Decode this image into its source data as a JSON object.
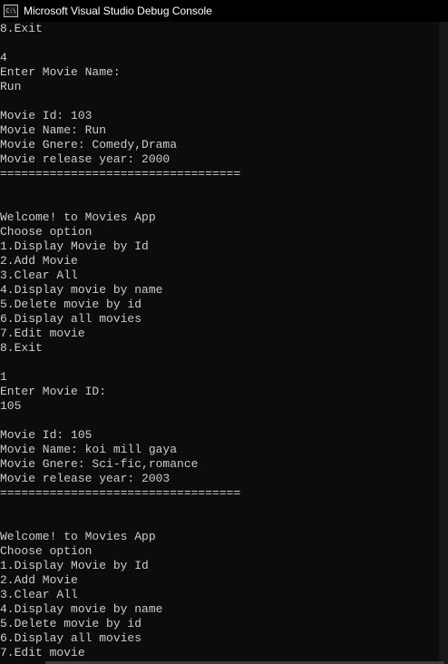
{
  "window": {
    "title": "Microsoft Visual Studio Debug Console",
    "icon": "console-app-icon",
    "icon_glyph": "C:\\"
  },
  "console": {
    "lines": [
      "8.Exit",
      "",
      "4",
      "Enter Movie Name:",
      "Run",
      "",
      "Movie Id: 103",
      "Movie Name: Run",
      "Movie Gnere: Comedy,Drama",
      "Movie release year: 2000",
      "==================================",
      "",
      "",
      "Welcome! to Movies App",
      "Choose option",
      "1.Display Movie by Id",
      "2.Add Movie",
      "3.Clear All",
      "4.Display movie by name",
      "5.Delete movie by id",
      "6.Display all movies",
      "7.Edit movie",
      "8.Exit",
      "",
      "1",
      "Enter Movie ID:",
      "105",
      "",
      "Movie Id: 105",
      "Movie Name: koi mill gaya",
      "Movie Gnere: Sci-fic,romance",
      "Movie release year: 2003",
      "==================================",
      "",
      "",
      "Welcome! to Movies App",
      "Choose option",
      "1.Display Movie by Id",
      "2.Add Movie",
      "3.Clear All",
      "4.Display movie by name",
      "5.Delete movie by id",
      "6.Display all movies",
      "7.Edit movie"
    ]
  },
  "colors": {
    "background": "#0c0c0c",
    "text": "#cccccc",
    "titlebar": "#000000"
  }
}
